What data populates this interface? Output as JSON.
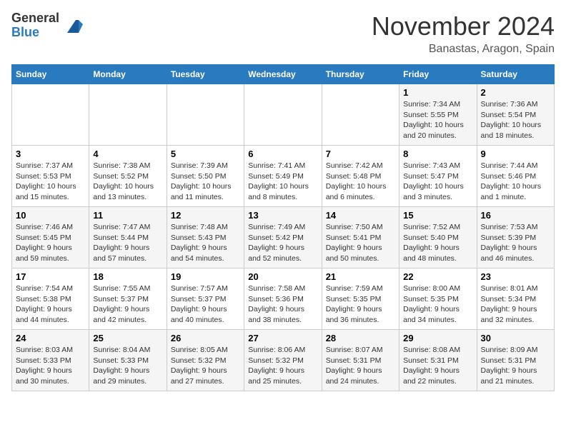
{
  "header": {
    "logo_line1": "General",
    "logo_line2": "Blue",
    "month": "November 2024",
    "location": "Banastas, Aragon, Spain"
  },
  "weekdays": [
    "Sunday",
    "Monday",
    "Tuesday",
    "Wednesday",
    "Thursday",
    "Friday",
    "Saturday"
  ],
  "weeks": [
    [
      {
        "day": "",
        "info": ""
      },
      {
        "day": "",
        "info": ""
      },
      {
        "day": "",
        "info": ""
      },
      {
        "day": "",
        "info": ""
      },
      {
        "day": "",
        "info": ""
      },
      {
        "day": "1",
        "info": "Sunrise: 7:34 AM\nSunset: 5:55 PM\nDaylight: 10 hours\nand 20 minutes."
      },
      {
        "day": "2",
        "info": "Sunrise: 7:36 AM\nSunset: 5:54 PM\nDaylight: 10 hours\nand 18 minutes."
      }
    ],
    [
      {
        "day": "3",
        "info": "Sunrise: 7:37 AM\nSunset: 5:53 PM\nDaylight: 10 hours\nand 15 minutes."
      },
      {
        "day": "4",
        "info": "Sunrise: 7:38 AM\nSunset: 5:52 PM\nDaylight: 10 hours\nand 13 minutes."
      },
      {
        "day": "5",
        "info": "Sunrise: 7:39 AM\nSunset: 5:50 PM\nDaylight: 10 hours\nand 11 minutes."
      },
      {
        "day": "6",
        "info": "Sunrise: 7:41 AM\nSunset: 5:49 PM\nDaylight: 10 hours\nand 8 minutes."
      },
      {
        "day": "7",
        "info": "Sunrise: 7:42 AM\nSunset: 5:48 PM\nDaylight: 10 hours\nand 6 minutes."
      },
      {
        "day": "8",
        "info": "Sunrise: 7:43 AM\nSunset: 5:47 PM\nDaylight: 10 hours\nand 3 minutes."
      },
      {
        "day": "9",
        "info": "Sunrise: 7:44 AM\nSunset: 5:46 PM\nDaylight: 10 hours\nand 1 minute."
      }
    ],
    [
      {
        "day": "10",
        "info": "Sunrise: 7:46 AM\nSunset: 5:45 PM\nDaylight: 9 hours\nand 59 minutes."
      },
      {
        "day": "11",
        "info": "Sunrise: 7:47 AM\nSunset: 5:44 PM\nDaylight: 9 hours\nand 57 minutes."
      },
      {
        "day": "12",
        "info": "Sunrise: 7:48 AM\nSunset: 5:43 PM\nDaylight: 9 hours\nand 54 minutes."
      },
      {
        "day": "13",
        "info": "Sunrise: 7:49 AM\nSunset: 5:42 PM\nDaylight: 9 hours\nand 52 minutes."
      },
      {
        "day": "14",
        "info": "Sunrise: 7:50 AM\nSunset: 5:41 PM\nDaylight: 9 hours\nand 50 minutes."
      },
      {
        "day": "15",
        "info": "Sunrise: 7:52 AM\nSunset: 5:40 PM\nDaylight: 9 hours\nand 48 minutes."
      },
      {
        "day": "16",
        "info": "Sunrise: 7:53 AM\nSunset: 5:39 PM\nDaylight: 9 hours\nand 46 minutes."
      }
    ],
    [
      {
        "day": "17",
        "info": "Sunrise: 7:54 AM\nSunset: 5:38 PM\nDaylight: 9 hours\nand 44 minutes."
      },
      {
        "day": "18",
        "info": "Sunrise: 7:55 AM\nSunset: 5:37 PM\nDaylight: 9 hours\nand 42 minutes."
      },
      {
        "day": "19",
        "info": "Sunrise: 7:57 AM\nSunset: 5:37 PM\nDaylight: 9 hours\nand 40 minutes."
      },
      {
        "day": "20",
        "info": "Sunrise: 7:58 AM\nSunset: 5:36 PM\nDaylight: 9 hours\nand 38 minutes."
      },
      {
        "day": "21",
        "info": "Sunrise: 7:59 AM\nSunset: 5:35 PM\nDaylight: 9 hours\nand 36 minutes."
      },
      {
        "day": "22",
        "info": "Sunrise: 8:00 AM\nSunset: 5:35 PM\nDaylight: 9 hours\nand 34 minutes."
      },
      {
        "day": "23",
        "info": "Sunrise: 8:01 AM\nSunset: 5:34 PM\nDaylight: 9 hours\nand 32 minutes."
      }
    ],
    [
      {
        "day": "24",
        "info": "Sunrise: 8:03 AM\nSunset: 5:33 PM\nDaylight: 9 hours\nand 30 minutes."
      },
      {
        "day": "25",
        "info": "Sunrise: 8:04 AM\nSunset: 5:33 PM\nDaylight: 9 hours\nand 29 minutes."
      },
      {
        "day": "26",
        "info": "Sunrise: 8:05 AM\nSunset: 5:32 PM\nDaylight: 9 hours\nand 27 minutes."
      },
      {
        "day": "27",
        "info": "Sunrise: 8:06 AM\nSunset: 5:32 PM\nDaylight: 9 hours\nand 25 minutes."
      },
      {
        "day": "28",
        "info": "Sunrise: 8:07 AM\nSunset: 5:31 PM\nDaylight: 9 hours\nand 24 minutes."
      },
      {
        "day": "29",
        "info": "Sunrise: 8:08 AM\nSunset: 5:31 PM\nDaylight: 9 hours\nand 22 minutes."
      },
      {
        "day": "30",
        "info": "Sunrise: 8:09 AM\nSunset: 5:31 PM\nDaylight: 9 hours\nand 21 minutes."
      }
    ]
  ]
}
